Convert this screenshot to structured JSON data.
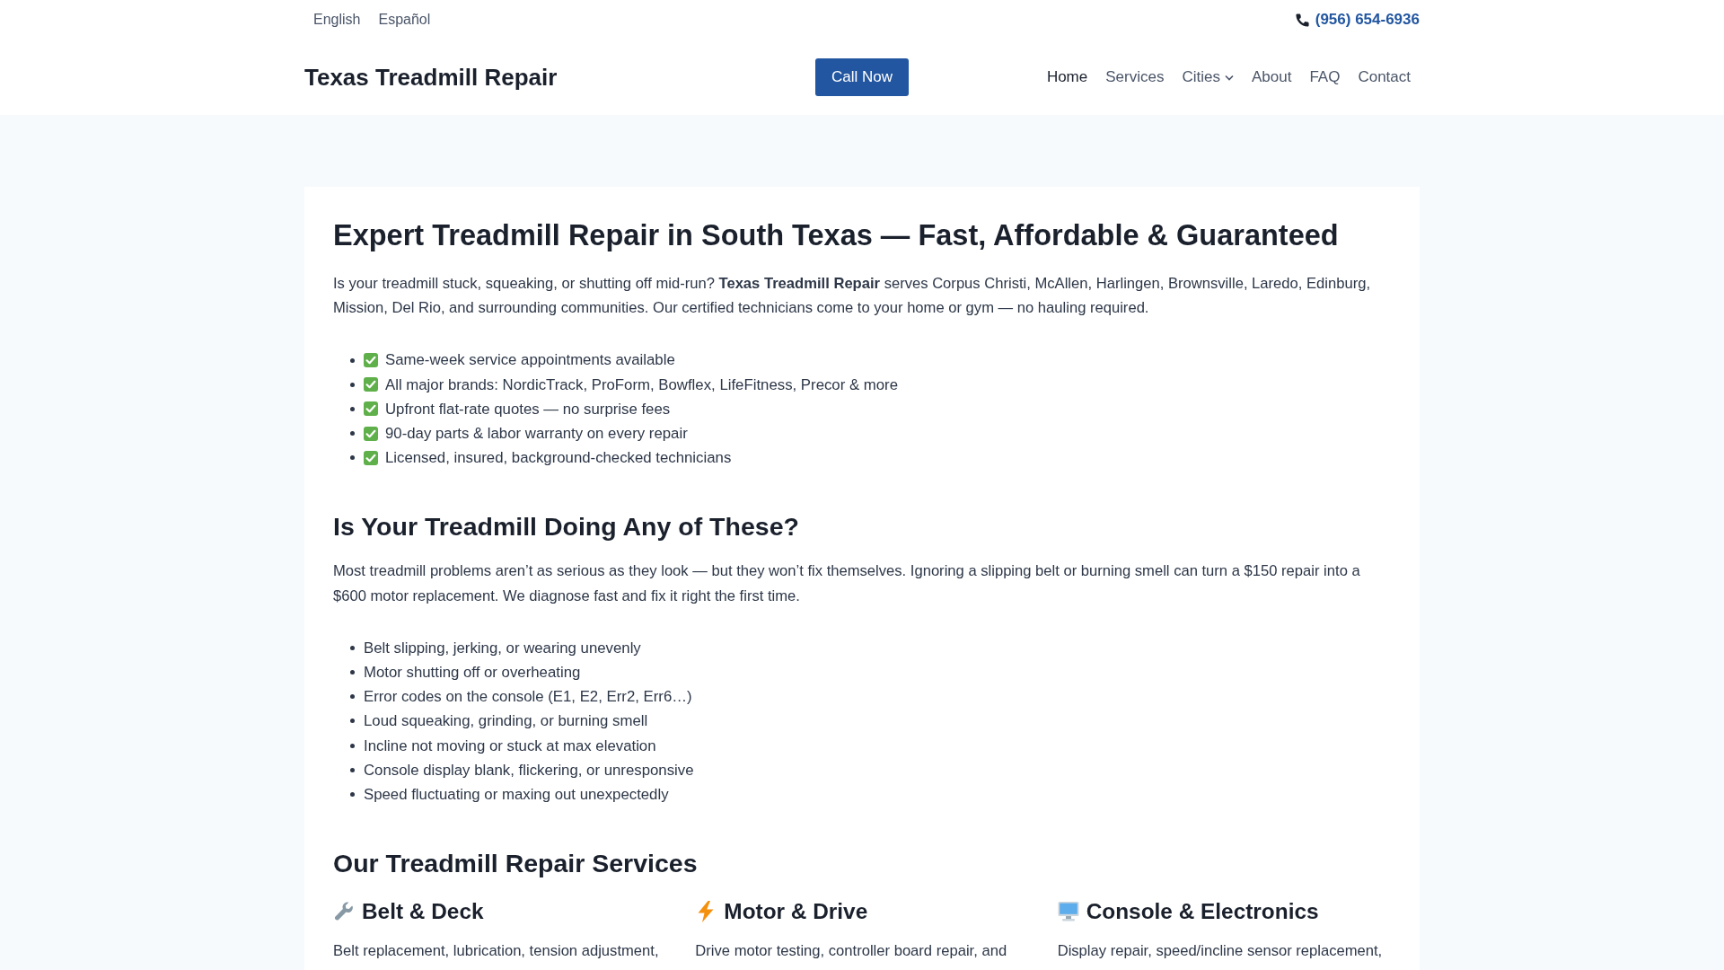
{
  "top_bar": {
    "languages": [
      "English",
      "Español"
    ],
    "phone": "(956) 654-6936"
  },
  "header": {
    "logo": "Texas Treadmill Repair",
    "cta_button": "Call Now",
    "nav": [
      {
        "label": "Home",
        "selected": true,
        "dropdown": false
      },
      {
        "label": "Services",
        "selected": false,
        "dropdown": false
      },
      {
        "label": "Cities",
        "selected": false,
        "dropdown": true
      },
      {
        "label": "About",
        "selected": false,
        "dropdown": false
      },
      {
        "label": "FAQ",
        "selected": false,
        "dropdown": false
      },
      {
        "label": "Contact",
        "selected": false,
        "dropdown": false
      }
    ]
  },
  "main": {
    "title": "Expert Treadmill Repair in South Texas — Fast, Affordable & Guaranteed",
    "intro": "Is your treadmill stuck, squeaking, or shutting off mid-run? **Texas Treadmill Repair** serves Corpus Christi, McAllen, Harlingen, Brownsville, Laredo, Edinburg, Mission, Del Rio, and surrounding communities. Our certified technicians come to your home or gym — no hauling required.",
    "highlights": [
      "Same-week service appointments available",
      "All major brands: NordicTrack, ProForm, Bowflex, LifeFitness, Precor & more",
      "Upfront flat-rate quotes — no surprise fees",
      "90-day parts & labor warranty on every repair",
      "Licensed, insured, background-checked technicians"
    ],
    "problems": {
      "heading": "Is Your Treadmill Doing Any of These?",
      "text": "Most treadmill problems aren’t as serious as they look — but they won’t fix themselves. Ignoring a slipping belt or burning smell can turn a $150 repair into a $600 motor replacement. We diagnose fast and fix it right the first time.",
      "items": [
        "Belt slipping, jerking, or wearing unevenly",
        "Motor shutting off or overheating",
        "Error codes on the console (E1, E2, Err2, Err6…)",
        "Loud squeaking, grinding, or burning smell",
        "Incline not moving or stuck at max elevation",
        "Console display blank, flickering, or unresponsive",
        "Speed fluctuating or maxing out unexpectedly"
      ]
    },
    "services": {
      "heading": "Our Treadmill Repair Services",
      "items": [
        {
          "title": "Belt & Deck",
          "text": "Belt replacement, lubrication, tension adjustment,"
        },
        {
          "title": "Motor & Drive",
          "text": "Drive motor testing, controller board repair, and"
        },
        {
          "title": "Console & Electronics",
          "text": "Display repair, speed/incline sensor replacement,"
        }
      ]
    }
  }
}
